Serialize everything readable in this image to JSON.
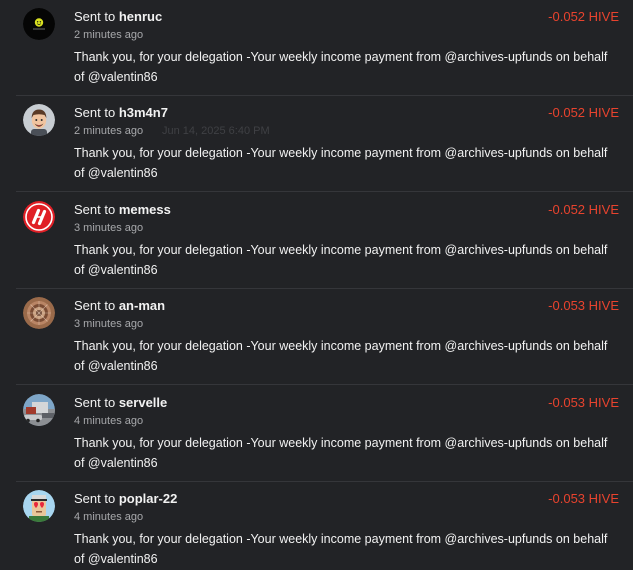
{
  "transfers": [
    {
      "prefix": "Sent to",
      "recipient": "henruc",
      "time": "2 minutes ago",
      "amount": "-0.052 HIVE",
      "memo": "Thank you, for your delegation -Your weekly income payment from @archives-upfunds on behalf of @valentin86"
    },
    {
      "prefix": "Sent to",
      "recipient": "h3m4n7",
      "time": "2 minutes ago",
      "time_tooltip": "Jun 14, 2025 6:40 PM",
      "amount": "-0.052 HIVE",
      "memo": "Thank you, for your delegation -Your weekly income payment from @archives-upfunds on behalf of @valentin86"
    },
    {
      "prefix": "Sent to",
      "recipient": "memess",
      "time": "3 minutes ago",
      "amount": "-0.052 HIVE",
      "memo": "Thank you, for your delegation -Your weekly income payment from @archives-upfunds on behalf of @valentin86"
    },
    {
      "prefix": "Sent to",
      "recipient": "an-man",
      "time": "3 minutes ago",
      "amount": "-0.053 HIVE",
      "memo": "Thank you, for your delegation -Your weekly income payment from @archives-upfunds on behalf of @valentin86"
    },
    {
      "prefix": "Sent to",
      "recipient": "servelle",
      "time": "4 minutes ago",
      "amount": "-0.053 HIVE",
      "memo": "Thank you, for your delegation -Your weekly income payment from @archives-upfunds on behalf of @valentin86"
    },
    {
      "prefix": "Sent to",
      "recipient": "poplar-22",
      "time": "4 minutes ago",
      "amount": "-0.053 HIVE",
      "memo": "Thank you, for your delegation -Your weekly income payment from @archives-upfunds on behalf of @valentin86"
    }
  ],
  "colors": {
    "background": "#222326",
    "amount_negative": "#e8432e",
    "text": "#f2f2f2",
    "muted": "#a7a8ab"
  }
}
